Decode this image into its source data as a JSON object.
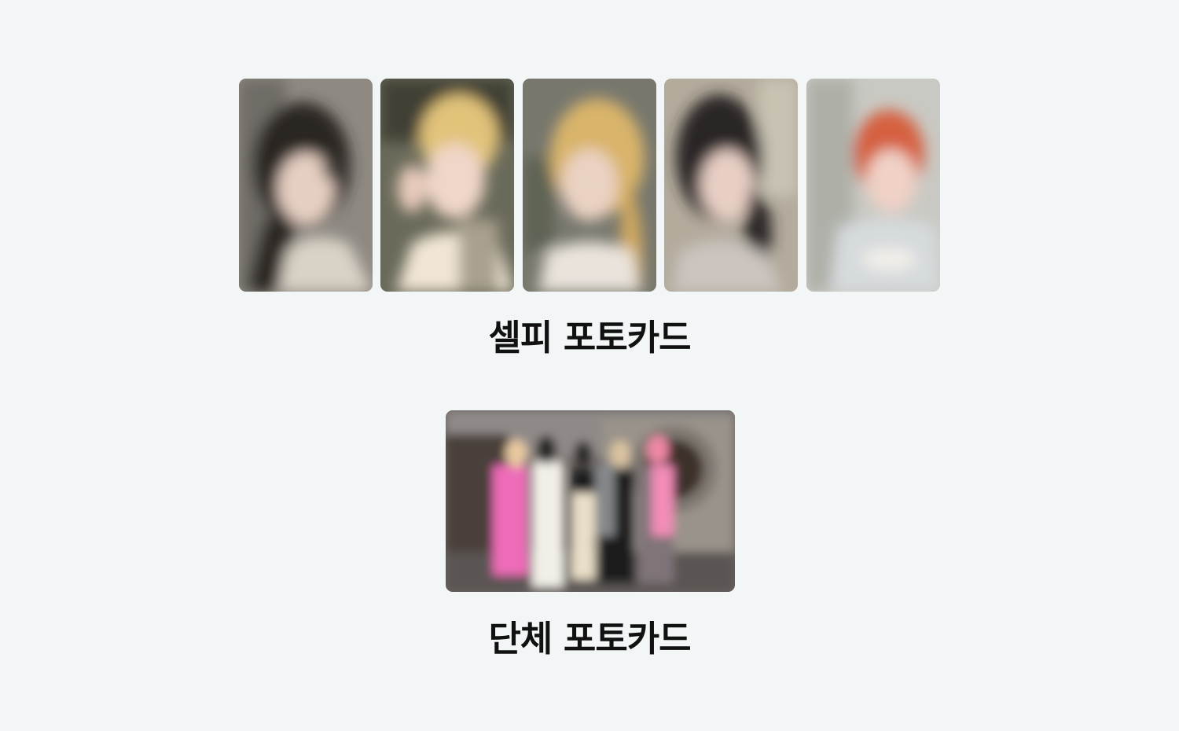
{
  "selfie_section": {
    "title": "셀피 포토카드",
    "cards": [
      {
        "name": "selfie-card-1",
        "bg": "#8e8a83",
        "hair": "#2a2624",
        "skin": "#e6cfc2",
        "top": "#d9d2c6"
      },
      {
        "name": "selfie-card-2",
        "bg": "#6a6a5a",
        "hair": "#e1c37a",
        "skin": "#efd6c8",
        "top": "#f1e6d6"
      },
      {
        "name": "selfie-card-3",
        "bg": "#77776d",
        "hair": "#d9b46a",
        "skin": "#ead2c2",
        "top": "#e9e3dc"
      },
      {
        "name": "selfie-card-4",
        "bg": "#b3ab9c",
        "hair": "#2c2727",
        "skin": "#e8cfc5",
        "top": "#cbc4bf"
      },
      {
        "name": "selfie-card-5",
        "bg": "#c9c9c3",
        "hair": "#d5603f",
        "skin": "#f0d1c6",
        "top": "#d6dadd"
      }
    ]
  },
  "group_section": {
    "title": "단체 포토카드"
  },
  "colors": {
    "background": "#f3f6f7",
    "title_text": "#111111"
  }
}
